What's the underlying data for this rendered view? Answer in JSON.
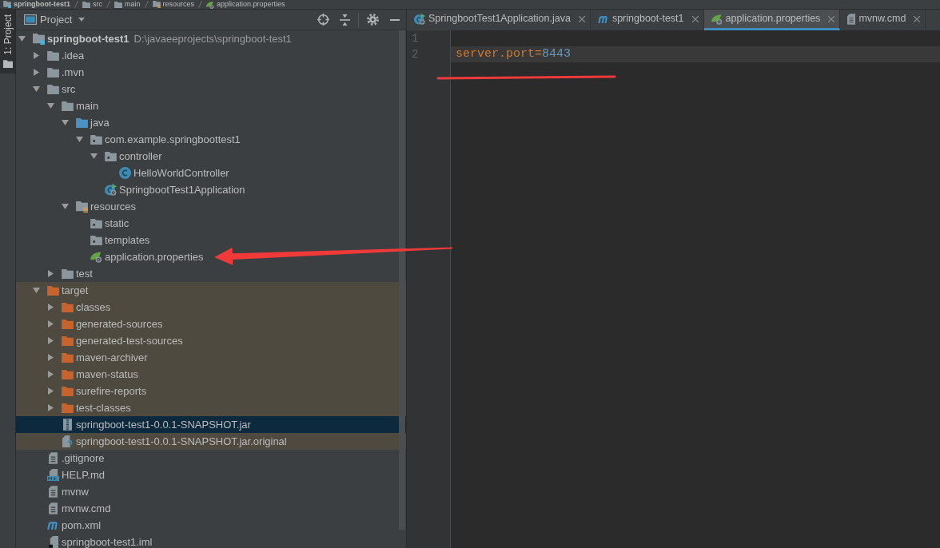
{
  "breadcrumb": [
    {
      "label": "springboot-test1",
      "kind": "module"
    },
    {
      "label": "src",
      "kind": "folder"
    },
    {
      "label": "main",
      "kind": "folder"
    },
    {
      "label": "resources",
      "kind": "resources-folder"
    },
    {
      "label": "application.properties",
      "kind": "properties"
    }
  ],
  "tool_strip": {
    "tabs": [
      {
        "label": "1: Project",
        "selected": true
      }
    ]
  },
  "project_panel": {
    "title": "Project",
    "tree": [
      {
        "label": "springboot-test1",
        "path": "D:\\javaeeprojects\\springboot-test1",
        "kind": "module",
        "expanded": true,
        "selected": false,
        "excluded": false,
        "children": [
          {
            "label": ".idea",
            "kind": "folder",
            "expanded": false,
            "selected": false,
            "excluded": false
          },
          {
            "label": ".mvn",
            "kind": "folder",
            "expanded": false,
            "selected": false,
            "excluded": false
          },
          {
            "label": "src",
            "kind": "folder",
            "expanded": true,
            "selected": false,
            "excluded": false,
            "children": [
              {
                "label": "main",
                "kind": "folder",
                "expanded": true,
                "selected": false,
                "excluded": false,
                "children": [
                  {
                    "label": "java",
                    "kind": "source-folder",
                    "expanded": true,
                    "selected": false,
                    "excluded": false,
                    "children": [
                      {
                        "label": "com.example.springboottest1",
                        "kind": "package",
                        "expanded": true,
                        "selected": false,
                        "excluded": false,
                        "children": [
                          {
                            "label": "controller",
                            "kind": "package",
                            "expanded": true,
                            "selected": false,
                            "excluded": false,
                            "children": [
                              {
                                "label": "HelloWorldController",
                                "kind": "class",
                                "selected": false,
                                "excluded": false
                              }
                            ]
                          },
                          {
                            "label": "SpringbootTest1Application",
                            "kind": "runnable-class",
                            "selected": false,
                            "excluded": false
                          }
                        ]
                      }
                    ]
                  },
                  {
                    "label": "resources",
                    "kind": "resources-folder",
                    "expanded": true,
                    "selected": false,
                    "excluded": false,
                    "children": [
                      {
                        "label": "static",
                        "kind": "package",
                        "selected": false,
                        "excluded": false
                      },
                      {
                        "label": "templates",
                        "kind": "package",
                        "selected": false,
                        "excluded": false
                      },
                      {
                        "label": "application.properties",
                        "kind": "properties",
                        "selected": false,
                        "excluded": false
                      }
                    ]
                  }
                ]
              },
              {
                "label": "test",
                "kind": "folder",
                "expanded": false,
                "selected": false,
                "excluded": false
              }
            ]
          },
          {
            "label": "target",
            "kind": "excluded-folder",
            "expanded": true,
            "selected": false,
            "excluded": true,
            "children": [
              {
                "label": "classes",
                "kind": "excluded-folder",
                "expanded": false,
                "selected": false,
                "excluded": true
              },
              {
                "label": "generated-sources",
                "kind": "excluded-folder",
                "expanded": false,
                "selected": false,
                "excluded": true
              },
              {
                "label": "generated-test-sources",
                "kind": "excluded-folder",
                "expanded": false,
                "selected": false,
                "excluded": true
              },
              {
                "label": "maven-archiver",
                "kind": "excluded-folder",
                "expanded": false,
                "selected": false,
                "excluded": true
              },
              {
                "label": "maven-status",
                "kind": "excluded-folder",
                "expanded": false,
                "selected": false,
                "excluded": true
              },
              {
                "label": "surefire-reports",
                "kind": "excluded-folder",
                "expanded": false,
                "selected": false,
                "excluded": true
              },
              {
                "label": "test-classes",
                "kind": "excluded-folder",
                "expanded": false,
                "selected": false,
                "excluded": true
              },
              {
                "label": "springboot-test1-0.0.1-SNAPSHOT.jar",
                "kind": "archive",
                "selected": true
              },
              {
                "label": "springboot-test1-0.0.1-SNAPSHOT.jar.original",
                "kind": "unknown-file",
                "selected": false,
                "excluded": true
              }
            ]
          },
          {
            "label": ".gitignore",
            "kind": "text-file",
            "selected": false,
            "excluded": false
          },
          {
            "label": "HELP.md",
            "kind": "markdown",
            "selected": false,
            "excluded": false
          },
          {
            "label": "mvnw",
            "kind": "text-file",
            "selected": false,
            "excluded": false
          },
          {
            "label": "mvnw.cmd",
            "kind": "text-file",
            "selected": false,
            "excluded": false
          },
          {
            "label": "pom.xml",
            "kind": "maven",
            "selected": false,
            "excluded": false
          },
          {
            "label": "springboot-test1.iml",
            "kind": "module-file",
            "selected": false,
            "excluded": false
          }
        ]
      }
    ]
  },
  "editor": {
    "tabs": [
      {
        "label": "SpringbootTest1Application.java",
        "kind": "runnable-class",
        "selected": false
      },
      {
        "label": "springboot-test1",
        "kind": "maven",
        "selected": false
      },
      {
        "label": "application.properties",
        "kind": "properties",
        "selected": true
      },
      {
        "label": "mvnw.cmd",
        "kind": "text-file",
        "selected": false
      }
    ],
    "lines": [
      {
        "number": "1",
        "current": false
      },
      {
        "number": "2",
        "current": true,
        "tokens": [
          {
            "text": "server.port",
            "kind": "key"
          },
          {
            "text": "=",
            "kind": "separator"
          },
          {
            "text": "8443",
            "kind": "value"
          }
        ]
      }
    ]
  },
  "annotations": [
    {
      "kind": "underline"
    },
    {
      "kind": "arrow"
    }
  ]
}
